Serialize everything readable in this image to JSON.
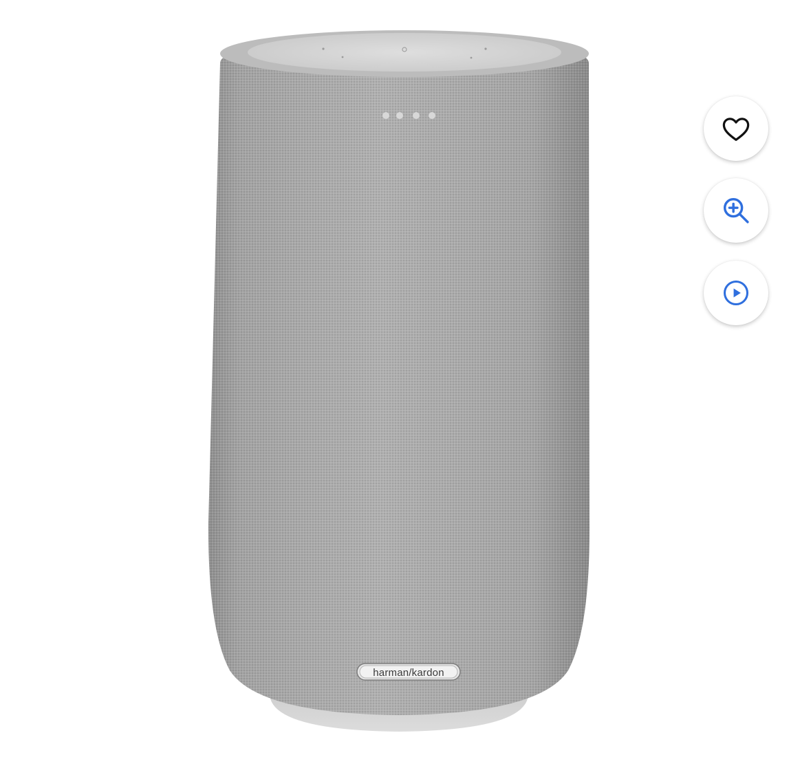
{
  "product": {
    "brand_logo_text": "harman/kardon",
    "image_icon": "speaker-product-image"
  },
  "actions": {
    "wishlist_icon": "heart-icon",
    "zoom_icon": "zoom-in-icon",
    "video_icon": "play-icon"
  },
  "colors": {
    "accent": "#2f6fde",
    "fabric": "#a6a6a6",
    "fabric_dark": "#8e8e8e",
    "top_cap": "#d6d6d6",
    "base": "#d2d2d2"
  }
}
